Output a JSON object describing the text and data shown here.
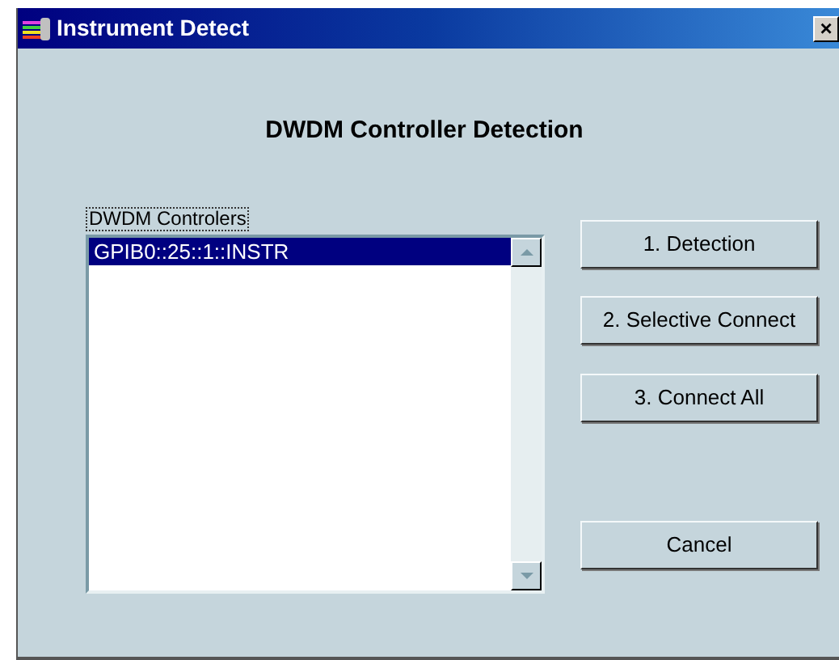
{
  "window": {
    "title": "Instrument Detect",
    "close": "×"
  },
  "heading": "DWDM Controller Detection",
  "list": {
    "label": "DWDM Controlers",
    "items": [
      {
        "text": "GPIB0::25::1::INSTR",
        "selected": true
      }
    ]
  },
  "buttons": [
    "1. Detection",
    "2. Selective Connect",
    "3. Connect All",
    "Cancel"
  ]
}
